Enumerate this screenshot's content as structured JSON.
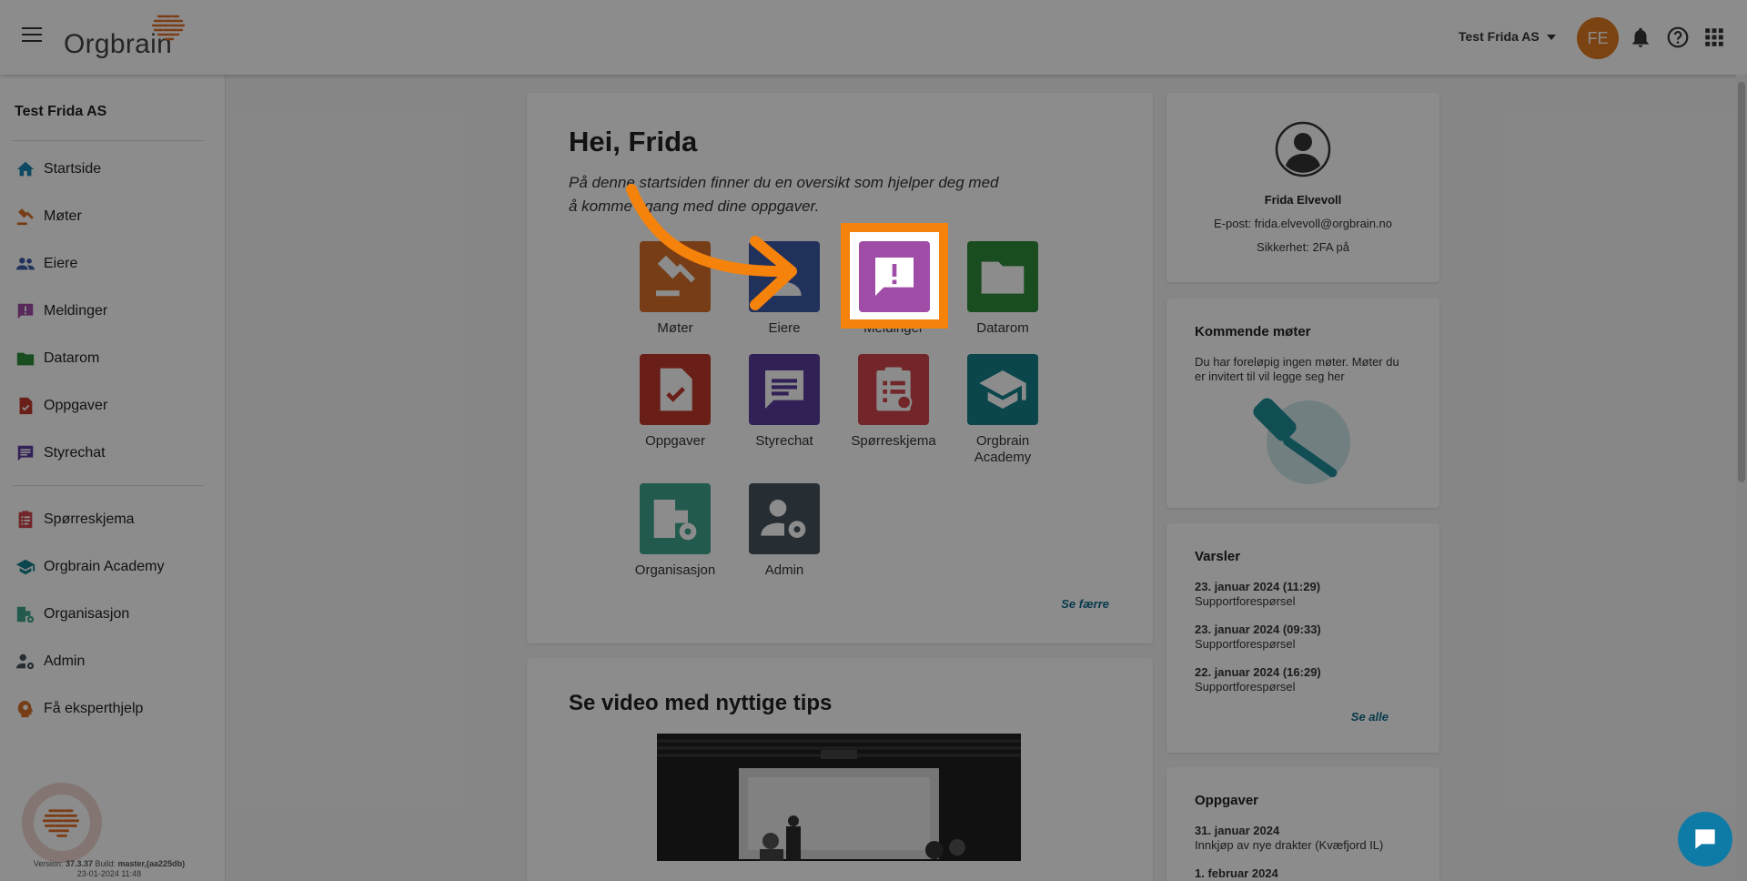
{
  "header": {
    "logo_text": "Orgbrain",
    "org_select": "Test Frida AS",
    "avatar_initials": "FE",
    "icons": [
      "hamburger-icon",
      "bell-icon",
      "help-icon",
      "apps-grid-icon"
    ]
  },
  "sidebar": {
    "org_name": "Test Frida AS",
    "items": [
      {
        "label": "Startside",
        "icon": "home-icon",
        "color": "#1b86b4"
      },
      {
        "label": "Møter",
        "icon": "gavel-icon",
        "color": "#d8702a"
      },
      {
        "label": "Eiere",
        "icon": "people-icon",
        "color": "#3b5aa8"
      },
      {
        "label": "Meldinger",
        "icon": "message-alert-icon",
        "color": "#a04da8"
      },
      {
        "label": "Datarom",
        "icon": "folder-icon",
        "color": "#2e8b3a"
      },
      {
        "label": "Oppgaver",
        "icon": "task-icon",
        "color": "#c0392b"
      },
      {
        "label": "Styrechat",
        "icon": "chat-icon",
        "color": "#5b3d9e"
      },
      {
        "label": "Spørreskjema",
        "icon": "survey-icon",
        "color": "#d0454c"
      },
      {
        "label": "Orgbrain Academy",
        "icon": "academy-icon",
        "color": "#13808a"
      },
      {
        "label": "Organisasjon",
        "icon": "organization-icon",
        "color": "#3fa58d"
      },
      {
        "label": "Admin",
        "icon": "admin-icon",
        "color": "#455560"
      },
      {
        "label": "Få eksperthjelp",
        "icon": "expert-help-icon",
        "color": "#d8702a"
      }
    ],
    "version_label": "Version:",
    "version": "37.3.37",
    "build_label": "Build:",
    "build": "master,(aa225db)",
    "build_date": "23-01-2024 11:48"
  },
  "main": {
    "greeting": "Hei, Frida",
    "intro": "På denne startsiden finner du en oversikt som hjelper deg med å komme i gang med dine oppgaver.",
    "tiles": [
      {
        "label": "Møter",
        "color": "#d8702a",
        "icon": "gavel-icon"
      },
      {
        "label": "Eiere",
        "color": "#3b5aa8",
        "icon": "owners-icon"
      },
      {
        "label": "Meldinger",
        "color": "#a04da8",
        "icon": "message-alert-icon"
      },
      {
        "label": "Datarom",
        "color": "#2e8b3a",
        "icon": "folder-icon"
      },
      {
        "label": "Oppgaver",
        "color": "#c0392b",
        "icon": "task-icon"
      },
      {
        "label": "Styrechat",
        "color": "#5b3d9e",
        "icon": "chat-icon"
      },
      {
        "label": "Spørreskjema",
        "color": "#d0454c",
        "icon": "survey-icon"
      },
      {
        "label": "Orgbrain Academy",
        "color": "#13808a",
        "icon": "academy-icon"
      },
      {
        "label": "Organisasjon",
        "color": "#3fa58d",
        "icon": "organization-icon"
      },
      {
        "label": "Admin",
        "color": "#455560",
        "icon": "admin-icon"
      }
    ],
    "see_less": "Se færre",
    "video_title": "Se video med nyttige tips"
  },
  "right": {
    "profile": {
      "name": "Frida Elvevoll",
      "email": "E-post: frida.elvevoll@orgbrain.no",
      "security": "Sikkerhet: 2FA på"
    },
    "meetings": {
      "title": "Kommende møter",
      "text": "Du har foreløpig ingen møter. Møter du er invitert til vil legge seg her"
    },
    "alerts": {
      "title": "Varsler",
      "items": [
        {
          "date": "23. januar 2024 (11:29)",
          "text": "Supportforespørsel"
        },
        {
          "date": "23. januar 2024 (09:33)",
          "text": "Supportforespørsel"
        },
        {
          "date": "22. januar 2024 (16:29)",
          "text": "Supportforespørsel"
        }
      ],
      "see_all": "Se alle"
    },
    "tasks": {
      "title": "Oppgaver",
      "items": [
        {
          "date": "31. januar 2024",
          "text": "Innkjøp av nye drakter (Kvæfjord IL)"
        },
        {
          "date": "1. februar 2024",
          "text": ""
        }
      ]
    }
  },
  "colors": {
    "accent_orange": "#f5820b",
    "link_teal": "#0e6a8a",
    "chat_button": "#0e7aa6"
  }
}
